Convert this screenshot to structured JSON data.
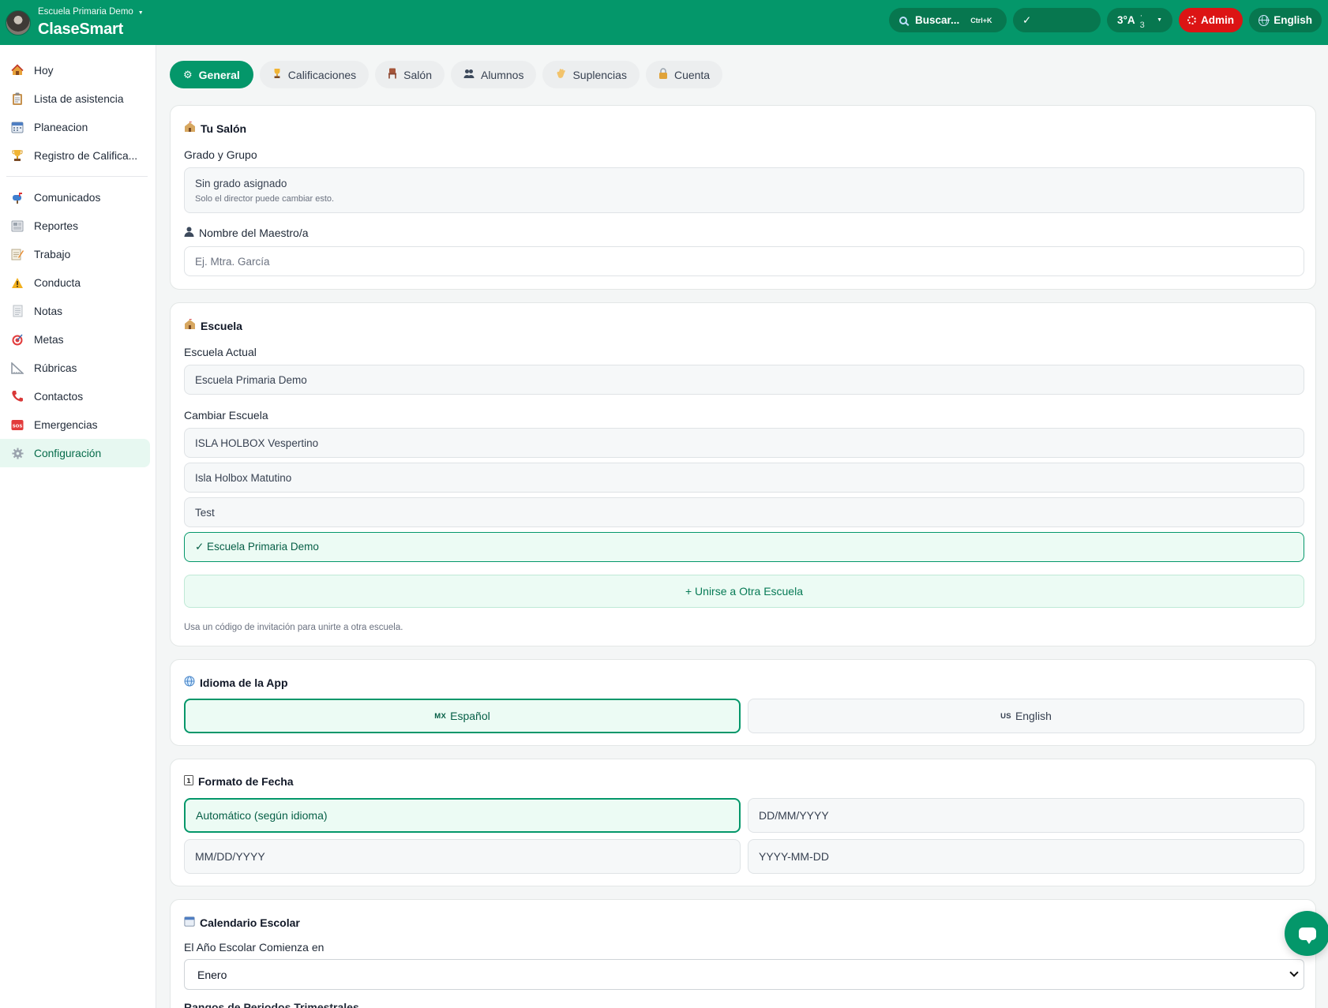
{
  "header": {
    "school_name": "Escuela Primaria Demo",
    "app_name": "ClaseSmart",
    "search_label": "Buscar...",
    "search_shortcut": "Ctrl+K",
    "check_label": "✓",
    "grade_label": "3°A",
    "grade_count": "· 3",
    "admin_label": "Admin",
    "language_label": "English"
  },
  "sidebar": {
    "items": [
      {
        "label": "Hoy",
        "icon": "home-icon"
      },
      {
        "label": "Lista de asistencia",
        "icon": "clipboard-icon"
      },
      {
        "label": "Planeacion",
        "icon": "calendar-icon"
      },
      {
        "label": "Registro de Califica...",
        "icon": "trophy-icon"
      },
      {
        "label": "Comunicados",
        "icon": "mailbox-icon"
      },
      {
        "label": "Reportes",
        "icon": "newspaper-icon"
      },
      {
        "label": "Trabajo",
        "icon": "memo-icon"
      },
      {
        "label": "Conducta",
        "icon": "warning-icon"
      },
      {
        "label": "Notas",
        "icon": "note-icon"
      },
      {
        "label": "Metas",
        "icon": "target-icon"
      },
      {
        "label": "Rúbricas",
        "icon": "ruler-icon"
      },
      {
        "label": "Contactos",
        "icon": "phone-icon"
      },
      {
        "label": "Emergencias",
        "icon": "sos-icon"
      },
      {
        "label": "Configuración",
        "icon": "gear-icon"
      }
    ],
    "active": "Configuración"
  },
  "tabs": [
    {
      "label": "General",
      "icon": "gear-icon"
    },
    {
      "label": "Calificaciones",
      "icon": "trophy-icon"
    },
    {
      "label": "Salón",
      "icon": "chair-icon"
    },
    {
      "label": "Alumnos",
      "icon": "people-icon"
    },
    {
      "label": "Suplencias",
      "icon": "wave-hand-icon"
    },
    {
      "label": "Cuenta",
      "icon": "lock-icon"
    }
  ],
  "salon": {
    "title": "Tu Salón",
    "grade_label": "Grado y Grupo",
    "grade_value": "Sin grado asignado",
    "grade_note": "Solo el director puede cambiar esto.",
    "teacher_label": "Nombre del Maestro/a",
    "teacher_placeholder": "Ej. Mtra. García"
  },
  "school": {
    "title": "Escuela",
    "current_label": "Escuela Actual",
    "current_value": "Escuela Primaria Demo",
    "change_label": "Cambiar Escuela",
    "options": [
      "ISLA HOLBOX Vespertino",
      "Isla Holbox Matutino",
      "Test",
      "✓ Escuela Primaria Demo"
    ],
    "join_label": "+ Unirse a Otra Escuela",
    "join_hint": "Usa un código de invitación para unirte a otra escuela."
  },
  "language": {
    "title": "Idioma de la App",
    "options": [
      {
        "flag": "MX",
        "label": "Español",
        "selected": true
      },
      {
        "flag": "US",
        "label": "English",
        "selected": false
      }
    ]
  },
  "date_format": {
    "title": "Formato de Fecha",
    "options": [
      "Automático (según idioma)",
      "DD/MM/YYYY",
      "MM/DD/YYYY",
      "YYYY-MM-DD"
    ],
    "selected": "Automático (según idioma)"
  },
  "calendar": {
    "title": "Calendario Escolar",
    "start_label": "El Año Escolar Comienza en",
    "start_value": "Enero",
    "periods_label": "Rangos de Periodos Trimestrales"
  },
  "colors": {
    "brand": "#04976a",
    "admin": "#dc1414",
    "selected_bg": "#ecfbf4"
  }
}
